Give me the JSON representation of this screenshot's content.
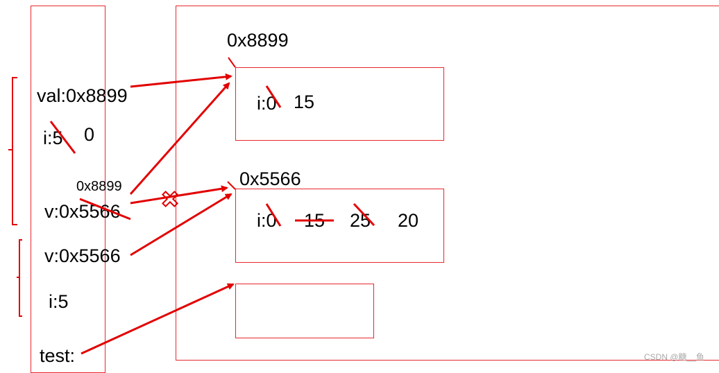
{
  "stack": {
    "val": "val:0x8899",
    "i_old": "i:5",
    "i_new": "0",
    "v_ref_label": "0x8899",
    "v1": "v:0x5566",
    "v2": "v:0x5566",
    "i2": "i:5",
    "test": "test:"
  },
  "heap": {
    "obj1": {
      "address": "0x8899",
      "field": "i:0",
      "value": "15"
    },
    "obj2": {
      "address": "0x5566",
      "field": "i:0",
      "values": [
        "15",
        "25",
        "20"
      ]
    }
  },
  "watermark": "CSDN @糖__鱼",
  "colors": {
    "accent": "#e8262b",
    "arrow": "#e20000"
  }
}
